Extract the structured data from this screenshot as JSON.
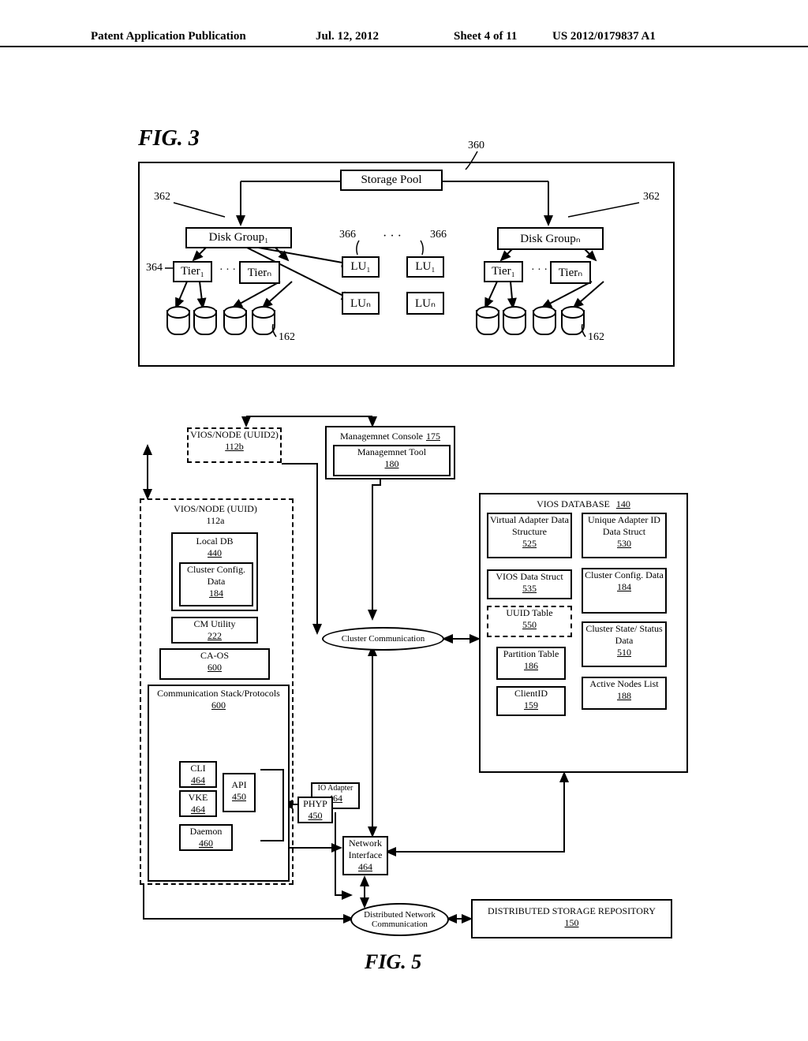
{
  "header": {
    "left": "Patent Application Publication",
    "mid": "Jul. 12, 2012",
    "sheet": "Sheet 4 of 11",
    "right": "US 2012/0179837 A1"
  },
  "fig3": {
    "title": "FIG. 3",
    "storage_pool": "Storage Pool",
    "ref_360": "360",
    "disk_group_1": "Disk Group₁",
    "disk_group_n": "Disk Groupₙ",
    "ref_362_l": "362",
    "ref_362_r": "362",
    "tier1_l": "Tier₁",
    "tiern_l": "Tierₙ",
    "tier1_r": "Tier₁",
    "tiern_r": "Tierₙ",
    "ref_364": "364",
    "lu1_l": "LU₁",
    "lun_l": "LUₙ",
    "lu1_r": "LU₁",
    "lun_r": "LUₙ",
    "ref_366_l": "366",
    "ref_366_r": "366",
    "dots": "· · ·",
    "ref_162_l": "162",
    "ref_162_r": "162"
  },
  "fig5": {
    "title": "FIG. 5",
    "mgmt_console": {
      "name": "Managemnet Console",
      "ref": "175"
    },
    "mgmt_tool": {
      "name": "Managemnet Tool",
      "ref": "180"
    },
    "vios2": {
      "name": "VIOS/NODE (UUID2)",
      "ref": "112b"
    },
    "vios1": {
      "name": "VIOS/NODE (UUID)",
      "ref": "112a"
    },
    "localdb": {
      "name": "Local DB",
      "ref": "440"
    },
    "cluster_cfg": {
      "name": "Cluster Config. Data",
      "ref": "184"
    },
    "cm_util": {
      "name": "CM Utility",
      "ref": "222"
    },
    "caos": {
      "name": "CA-OS",
      "ref": "600"
    },
    "commstack": {
      "name": "Communication Stack/Protocols",
      "ref": "600"
    },
    "cli": {
      "name": "CLI",
      "ref": "464"
    },
    "vke": {
      "name": "VKE",
      "ref": "464"
    },
    "api": {
      "name": "API",
      "ref": "450"
    },
    "daemon": {
      "name": "Daemon",
      "ref": "460"
    },
    "io_adapter": {
      "name": "IO Adapter",
      "ref": "464"
    },
    "phyp": {
      "name": "PHYP",
      "ref": "450"
    },
    "net_if": {
      "name": "Network Interface",
      "ref": "464"
    },
    "cluster_comm": "Cluster Communication",
    "dist_net_comm": "Distributed Network Communication",
    "vios_db": {
      "name": "VIOS DATABASE",
      "ref": "140"
    },
    "va_ds": {
      "name": "Virtual Adapter Data Structure",
      "ref": "525"
    },
    "ua_ds": {
      "name": "Unique Adapter ID Data Struct",
      "ref": "530"
    },
    "vios_ds": {
      "name": "VIOS Data Struct",
      "ref": "535"
    },
    "uuid_tbl": {
      "name": "UUID Table",
      "ref": "550"
    },
    "cc_data": {
      "name": "Cluster Config. Data",
      "ref": "184"
    },
    "cs_data": {
      "name": "Cluster State/ Status Data",
      "ref": "510"
    },
    "ptable": {
      "name": "Partition Table",
      "ref": "186"
    },
    "active": {
      "name": "Active Nodes List",
      "ref": "188"
    },
    "clientid": {
      "name": "ClientID",
      "ref": "159"
    },
    "dsr": {
      "name": "DISTRIBUTED STORAGE REPOSITORY",
      "ref": "150"
    }
  }
}
